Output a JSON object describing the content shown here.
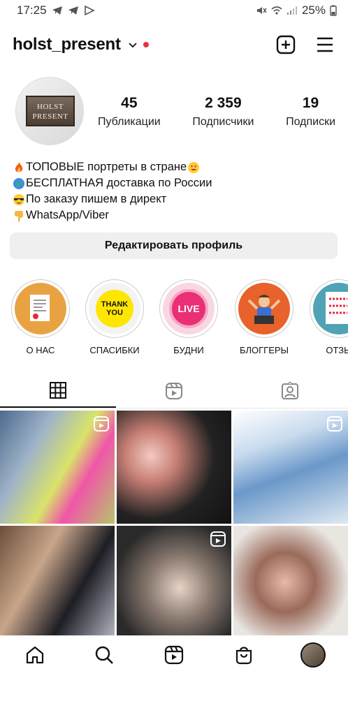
{
  "status_bar": {
    "time": "17:25",
    "battery": "25%"
  },
  "header": {
    "username": "holst_present"
  },
  "profile": {
    "avatar_sign_line1": "HOLST",
    "avatar_sign_line2": "PRESENT",
    "stats": [
      {
        "value": "45",
        "label": "Публикации"
      },
      {
        "value": "2 359",
        "label": "Подписчики"
      },
      {
        "value": "19",
        "label": "Подписки"
      }
    ],
    "bio": [
      {
        "emoji": "fire",
        "text": "ТОПОВЫЕ портреты в стране"
      },
      {
        "emoji": "globe",
        "text": "БЕСПЛАТНАЯ доставка по России"
      },
      {
        "emoji": "sunglasses",
        "text": "По заказу пишем в директ"
      },
      {
        "emoji": "point-down",
        "text": "WhatsApp/Viber"
      }
    ],
    "edit_button": "Редактировать профиль"
  },
  "highlights": [
    {
      "label": "О НАС",
      "inner_text": ""
    },
    {
      "label": "СПАСИБКИ",
      "inner_text": "THANK YOU"
    },
    {
      "label": "БУДНИ",
      "inner_text": "LIVE"
    },
    {
      "label": "БЛОГГЕРЫ",
      "inner_text": ""
    },
    {
      "label": "ОТЗЫ",
      "inner_text": ""
    }
  ],
  "tabs": [
    {
      "icon": "grid-icon",
      "active": true
    },
    {
      "icon": "reels-icon",
      "active": false
    },
    {
      "icon": "tagged-icon",
      "active": false
    }
  ],
  "colors": {
    "accent_red": "#e53343",
    "button_bg": "#efefef"
  }
}
